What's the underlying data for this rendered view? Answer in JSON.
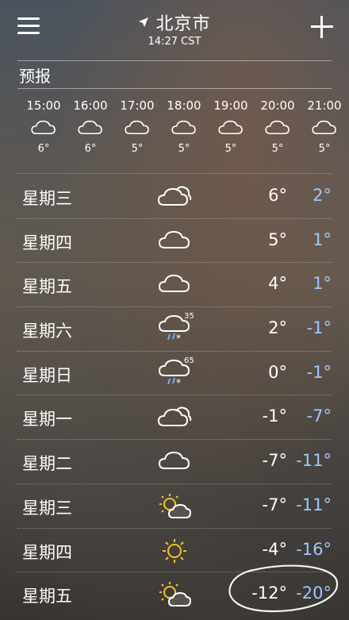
{
  "header": {
    "city": "北京市",
    "time": "14:27 CST"
  },
  "forecast_label": "预报",
  "hourly": [
    {
      "time": "15:00",
      "temp": "6°",
      "icon": "cloud-icon"
    },
    {
      "time": "16:00",
      "temp": "6°",
      "icon": "cloud-icon"
    },
    {
      "time": "17:00",
      "temp": "5°",
      "icon": "cloud-icon"
    },
    {
      "time": "18:00",
      "temp": "5°",
      "icon": "cloud-icon"
    },
    {
      "time": "19:00",
      "temp": "5°",
      "icon": "cloud-icon"
    },
    {
      "time": "20:00",
      "temp": "5°",
      "icon": "cloud-icon"
    },
    {
      "time": "21:00",
      "temp": "5°",
      "icon": "cloud-icon"
    }
  ],
  "daily": [
    {
      "day": "星期三",
      "icon": "partly-cloudy-icon",
      "pct": "",
      "hi": "6°",
      "lo": "2°"
    },
    {
      "day": "星期四",
      "icon": "cloud-icon",
      "pct": "",
      "hi": "5°",
      "lo": "1°"
    },
    {
      "day": "星期五",
      "icon": "cloud-icon",
      "pct": "",
      "hi": "4°",
      "lo": "1°"
    },
    {
      "day": "星期六",
      "icon": "snow-icon",
      "pct": "35",
      "hi": "2°",
      "lo": "-1°"
    },
    {
      "day": "星期日",
      "icon": "snow-icon",
      "pct": "65",
      "hi": "0°",
      "lo": "-1°"
    },
    {
      "day": "星期一",
      "icon": "partly-cloudy-icon",
      "pct": "",
      "hi": "-1°",
      "lo": "-7°"
    },
    {
      "day": "星期二",
      "icon": "cloud-icon",
      "pct": "",
      "hi": "-7°",
      "lo": "-11°"
    },
    {
      "day": "星期三",
      "icon": "sun-cloud-icon",
      "pct": "",
      "hi": "-7°",
      "lo": "-11°"
    },
    {
      "day": "星期四",
      "icon": "sun-icon",
      "pct": "",
      "hi": "-4°",
      "lo": "-16°"
    },
    {
      "day": "星期五",
      "icon": "sun-cloud-icon",
      "pct": "",
      "hi": "-12°",
      "lo": "-20°"
    }
  ],
  "colors": {
    "low_temp": "#9cc7ff",
    "sun": "#f3c12a"
  }
}
